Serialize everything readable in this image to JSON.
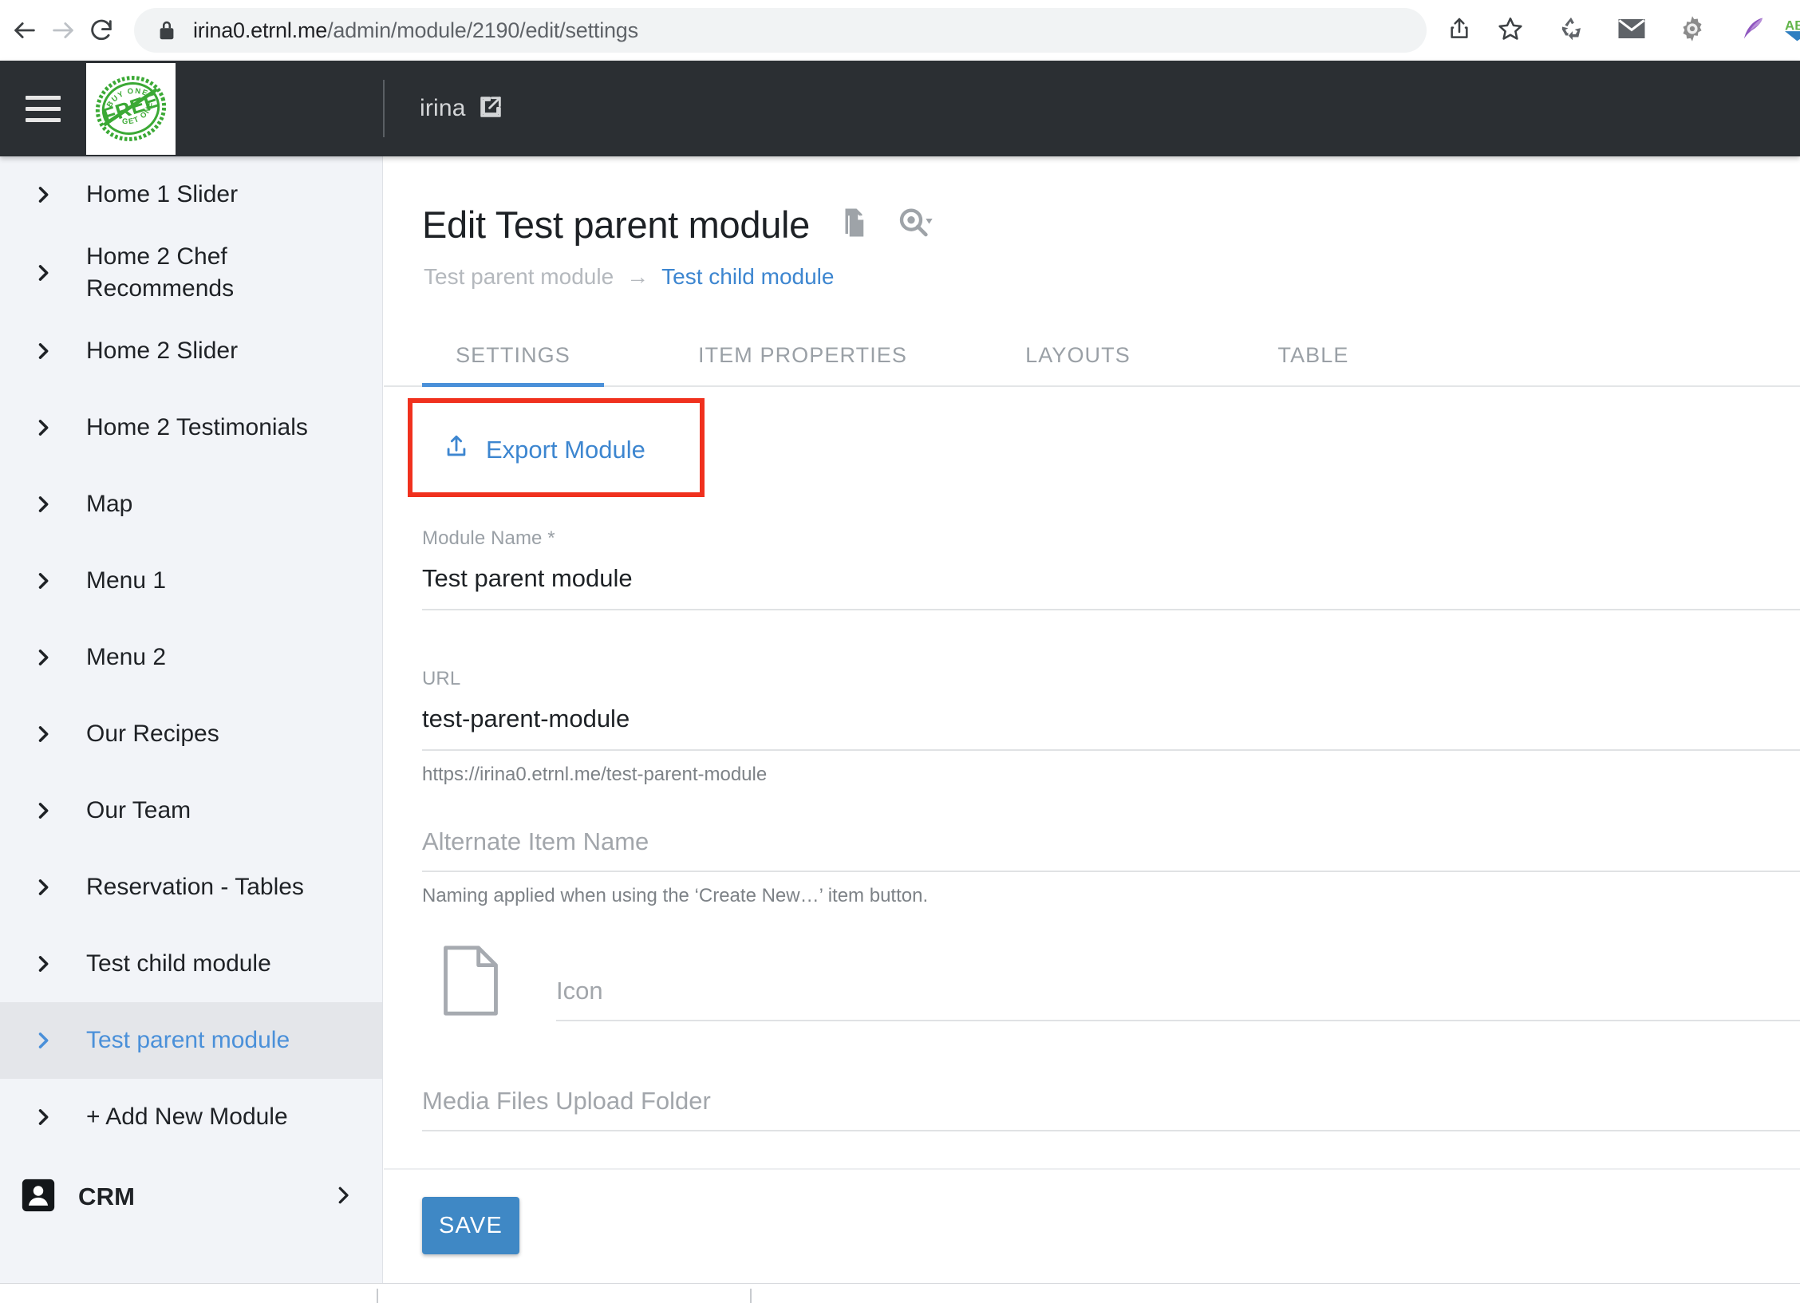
{
  "browser": {
    "url_host": "irina0.etrnl.me",
    "url_path": "/admin/module/2190/edit/settings",
    "back_icon": "back-arrow-icon",
    "forward_icon": "forward-arrow-icon",
    "reload_icon": "reload-icon",
    "lock_icon": "lock-icon",
    "share_icon": "share-icon",
    "bookmark_icon": "star-icon",
    "extensions": [
      "recycle-icon",
      "mail-icon",
      "gear-icon",
      "feather-icon",
      "ab-logo-icon"
    ]
  },
  "header": {
    "menu_icon": "hamburger-menu-icon",
    "logo_text": "FREE",
    "logo_top_text": "BUY ONE",
    "logo_bottom_text": "GET ONE",
    "site_name": "irina",
    "open_icon": "open-in-new-icon"
  },
  "sidebar": {
    "items": [
      {
        "label": "Home 1 Slider",
        "active": false
      },
      {
        "label": "Home 2 Chef Recommends",
        "active": false
      },
      {
        "label": "Home 2 Slider",
        "active": false
      },
      {
        "label": "Home 2 Testimonials",
        "active": false
      },
      {
        "label": "Map",
        "active": false
      },
      {
        "label": "Menu 1",
        "active": false
      },
      {
        "label": "Menu 2",
        "active": false
      },
      {
        "label": "Our Recipes",
        "active": false
      },
      {
        "label": "Our Team",
        "active": false
      },
      {
        "label": "Reservation - Tables",
        "active": false
      },
      {
        "label": "Test child module",
        "active": false
      },
      {
        "label": "Test parent module",
        "active": true
      },
      {
        "label": "+ Add New Module",
        "active": false
      }
    ],
    "crm": {
      "label": "CRM",
      "icon": "person-badge-icon",
      "chevron": "chevron-right-icon"
    }
  },
  "main": {
    "page_title": "Edit Test parent module",
    "duplicate_icon": "copy-icon",
    "preview_icon": "preview-search-icon",
    "breadcrumb": {
      "parent": "Test parent module",
      "arrow": "→",
      "child": "Test child module"
    },
    "tabs": [
      {
        "label": "SETTINGS",
        "active": true
      },
      {
        "label": "ITEM PROPERTIES",
        "active": false
      },
      {
        "label": "LAYOUTS",
        "active": false
      },
      {
        "label": "TABLE",
        "active": false
      }
    ],
    "export_button": {
      "label": "Export Module",
      "icon": "upload-icon",
      "highlight_color": "#f0311e"
    },
    "fields": {
      "module_name": {
        "label": "Module Name *",
        "value": "Test parent module"
      },
      "url": {
        "label": "URL",
        "value": "test-parent-module",
        "hint": "https://irina0.etrnl.me/test-parent-module"
      },
      "alternate_item_name": {
        "placeholder": "Alternate Item Name",
        "value": "",
        "hint": "Naming applied when using the ‘Create New…’ item button."
      },
      "icon": {
        "placeholder": "Icon",
        "value": "",
        "preview_icon": "document-file-icon"
      },
      "media_folder": {
        "placeholder": "Media Files Upload Folder",
        "value": ""
      }
    },
    "save_button": {
      "label": "SAVE",
      "color": "#3f88c5"
    }
  }
}
